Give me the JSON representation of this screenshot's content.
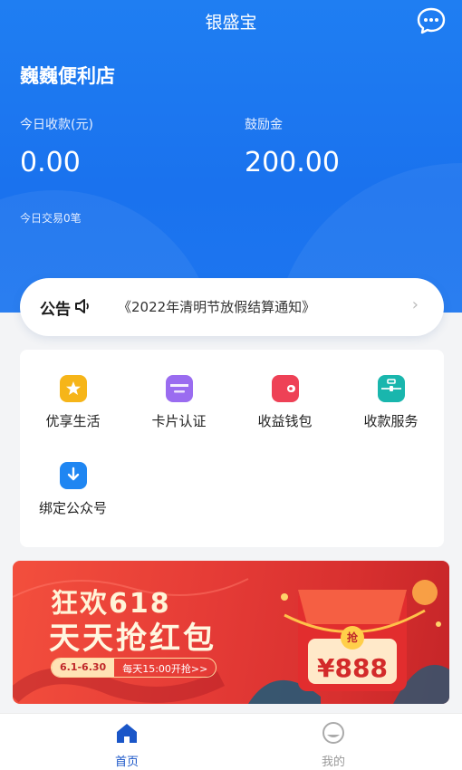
{
  "app": {
    "title": "银盛宝"
  },
  "header": {
    "store_name": "巍巍便利店",
    "today_income_label": "今日收款(元)",
    "today_income_value": "0.00",
    "bonus_label": "鼓励金",
    "bonus_value": "200.00",
    "today_trades": "今日交易0笔"
  },
  "notice": {
    "tag": "公告",
    "text": "《2022年清明节放假结算通知》",
    "arrow": "›"
  },
  "menu": {
    "items": [
      {
        "label": "优享生活",
        "icon": "star-badge-icon",
        "color": "#f6b519"
      },
      {
        "label": "卡片认证",
        "icon": "card-icon",
        "color": "#9a6cf0"
      },
      {
        "label": "收益钱包",
        "icon": "wallet-icon",
        "color": "#ee4156"
      },
      {
        "label": "收款服务",
        "icon": "briefcase-icon",
        "color": "#19b6ad"
      },
      {
        "label": "绑定公众号",
        "icon": "bookmark-download-icon",
        "color": "#1f86f2"
      }
    ]
  },
  "banner": {
    "line1": "狂欢618",
    "line2": "天天抢红包",
    "date_range": "6.1-6.30",
    "daily_start": "每天15:00开抢>>",
    "grab_badge": "抢",
    "price": "¥888"
  },
  "tabbar": {
    "home_label": "首页",
    "mine_label": "我的",
    "active_color": "#1a56c8",
    "inactive_color": "#999999"
  },
  "colors": {
    "brand_blue": "#1f7ef2"
  }
}
